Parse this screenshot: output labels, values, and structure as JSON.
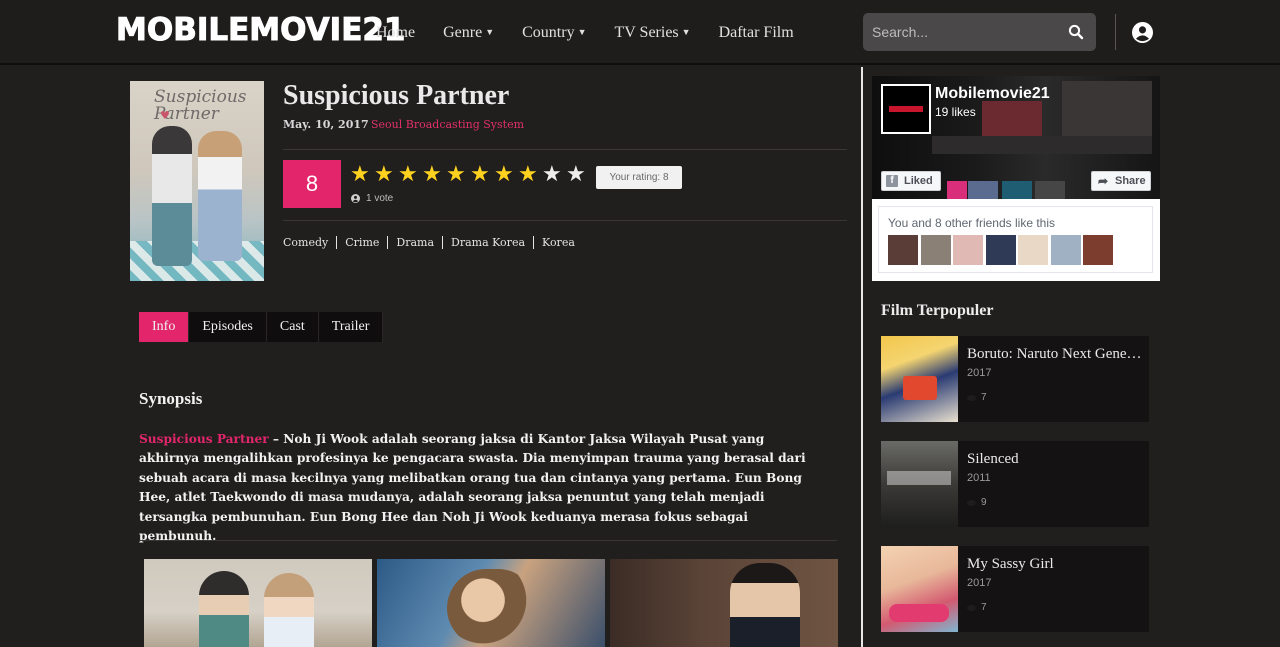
{
  "header": {
    "logo": "MOBILEMOVIE21",
    "nav": [
      {
        "label": "Home",
        "dropdown": false
      },
      {
        "label": "Genre",
        "dropdown": true
      },
      {
        "label": "Country",
        "dropdown": true
      },
      {
        "label": "TV Series",
        "dropdown": true
      },
      {
        "label": "Daftar Film",
        "dropdown": false
      }
    ],
    "search_placeholder": "Search...",
    "search_icon": "search-icon",
    "user_icon": "user-circle-icon"
  },
  "movie": {
    "poster_title": "Suspicious Partner",
    "title": "Suspicious Partner",
    "date": "May. 10, 2017",
    "network": "Seoul Broadcasting System",
    "rating": "8",
    "stars_filled": 8,
    "stars_total": 10,
    "your_rating": "Your rating: 8",
    "votes": "1 vote",
    "genres": [
      "Comedy",
      "Crime",
      "Drama",
      "Drama Korea",
      "Korea"
    ]
  },
  "tabs": [
    {
      "label": "Info",
      "active": true
    },
    {
      "label": "Episodes",
      "active": false
    },
    {
      "label": "Cast",
      "active": false
    },
    {
      "label": "Trailer",
      "active": false
    }
  ],
  "synopsis": {
    "heading": "Synopsis",
    "highlight": "Suspicious Partner",
    "text": " – Noh Ji Wook adalah seorang jaksa di Kantor Jaksa Wilayah Pusat yang akhirnya mengalihkan profesinya ke pengacara swasta. Dia menyimpan trauma yang berasal dari sebuah acara di masa kecilnya yang melibatkan orang tua dan cintanya yang pertama. Eun Bong Hee, atlet Taekwondo di masa mudanya, adalah seorang jaksa penuntut yang telah menjadi tersangka pembunuhan. Eun Bong Hee dan Noh Ji Wook keduanya merasa fokus sebagai pembunuh."
  },
  "sidebar": {
    "facebook": {
      "page_name": "Mobilemovie21",
      "likes": "19 likes",
      "liked_label": "Liked",
      "share_label": "Share",
      "friends_text": "You and 8 other friends like this"
    },
    "popular_heading": "Film Terpopuler",
    "popular": [
      {
        "title": "Boruto: Naruto Next Generations",
        "year": "2017",
        "views": "7"
      },
      {
        "title": "Silenced",
        "year": "2011",
        "views": "9"
      },
      {
        "title": "My Sassy Girl",
        "year": "2017",
        "views": "7"
      }
    ]
  },
  "colors": {
    "accent": "#e3266b",
    "star": "#ffd21f",
    "background": "#211e1e"
  }
}
